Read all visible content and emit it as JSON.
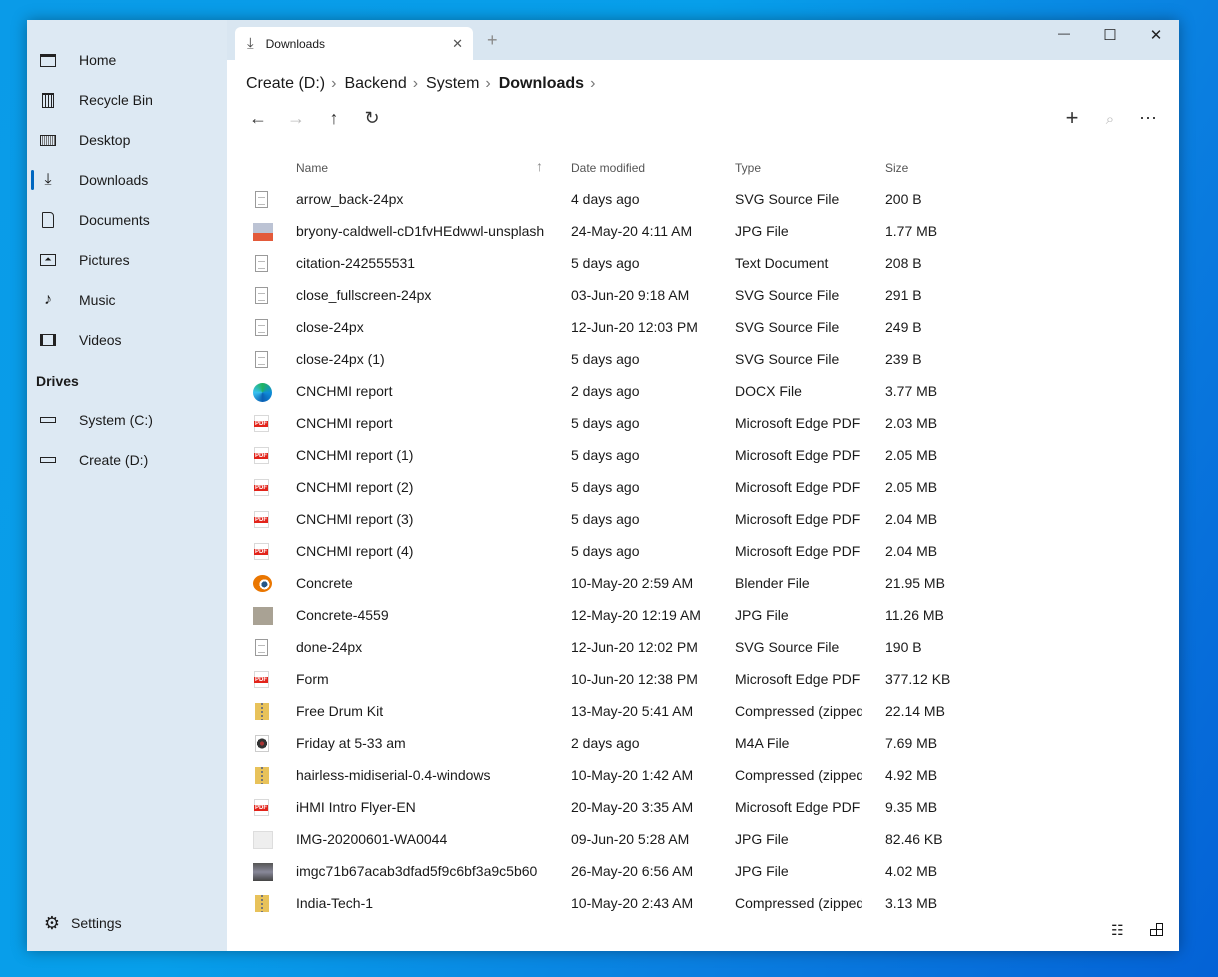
{
  "sidebar": {
    "items": [
      {
        "label": "Home",
        "icon": "home-icon"
      },
      {
        "label": "Recycle Bin",
        "icon": "trash-icon"
      },
      {
        "label": "Desktop",
        "icon": "desktop-icon"
      },
      {
        "label": "Downloads",
        "icon": "download-icon",
        "selected": true
      },
      {
        "label": "Documents",
        "icon": "document-icon"
      },
      {
        "label": "Pictures",
        "icon": "picture-icon"
      },
      {
        "label": "Music",
        "icon": "music-icon"
      },
      {
        "label": "Videos",
        "icon": "video-icon"
      }
    ],
    "drives_header": "Drives",
    "drives": [
      {
        "label": "System (C:)"
      },
      {
        "label": "Create (D:)"
      }
    ],
    "settings": "Settings"
  },
  "tab": {
    "label": "Downloads",
    "close": "✕",
    "new": "+"
  },
  "window_controls": {
    "minimize": "—",
    "maximize": "☐",
    "close": "✕"
  },
  "breadcrumb": [
    "Create (D:)",
    "Backend",
    "System",
    "Downloads"
  ],
  "columns": {
    "name": "Name",
    "date": "Date modified",
    "type": "Type",
    "size": "Size",
    "sort": "ascending"
  },
  "accent": "#0067c0",
  "files": [
    {
      "name": "arrow_back-24px",
      "date": "4 days ago",
      "type": "SVG Source File",
      "size": "200 B",
      "icon": "doc"
    },
    {
      "name": "bryony-caldwell-cD1fvHEdwwl-unsplash",
      "date": "24-May-20 4:11 AM",
      "type": "JPG File",
      "size": "1.77 MB",
      "icon": "img1"
    },
    {
      "name": "citation-242555531",
      "date": "5 days ago",
      "type": "Text Document",
      "size": "208 B",
      "icon": "doc"
    },
    {
      "name": "close_fullscreen-24px",
      "date": "03-Jun-20 9:18 AM",
      "type": "SVG Source File",
      "size": "291 B",
      "icon": "doc"
    },
    {
      "name": "close-24px",
      "date": "12-Jun-20 12:03 PM",
      "type": "SVG Source File",
      "size": "249 B",
      "icon": "doc"
    },
    {
      "name": "close-24px (1)",
      "date": "5 days ago",
      "type": "SVG Source File",
      "size": "239 B",
      "icon": "doc"
    },
    {
      "name": "CNCHMI report",
      "date": "2 days ago",
      "type": "DOCX File",
      "size": "3.77 MB",
      "icon": "edge"
    },
    {
      "name": "CNCHMI report",
      "date": "5 days ago",
      "type": "Microsoft Edge PDF Document",
      "size": "2.03 MB",
      "icon": "pdf"
    },
    {
      "name": "CNCHMI report (1)",
      "date": "5 days ago",
      "type": "Microsoft Edge PDF Document",
      "size": "2.05 MB",
      "icon": "pdf"
    },
    {
      "name": "CNCHMI report (2)",
      "date": "5 days ago",
      "type": "Microsoft Edge PDF Document",
      "size": "2.05 MB",
      "icon": "pdf"
    },
    {
      "name": "CNCHMI report (3)",
      "date": "5 days ago",
      "type": "Microsoft Edge PDF Document",
      "size": "2.04 MB",
      "icon": "pdf"
    },
    {
      "name": "CNCHMI report (4)",
      "date": "5 days ago",
      "type": "Microsoft Edge PDF Document",
      "size": "2.04 MB",
      "icon": "pdf"
    },
    {
      "name": "Concrete",
      "date": "10-May-20 2:59 AM",
      "type": "Blender File",
      "size": "21.95 MB",
      "icon": "blender"
    },
    {
      "name": "Concrete-4559",
      "date": "12-May-20 12:19 AM",
      "type": "JPG File",
      "size": "11.26 MB",
      "icon": "img2"
    },
    {
      "name": "done-24px",
      "date": "12-Jun-20 12:02 PM",
      "type": "SVG Source File",
      "size": "190 B",
      "icon": "doc"
    },
    {
      "name": "Form",
      "date": "10-Jun-20 12:38 PM",
      "type": "Microsoft Edge PDF Document",
      "size": "377.12 KB",
      "icon": "pdf"
    },
    {
      "name": "Free Drum Kit",
      "date": "13-May-20 5:41 AM",
      "type": "Compressed (zipped) Folder",
      "size": "22.14 MB",
      "icon": "zip"
    },
    {
      "name": "Friday at 5-33 am",
      "date": "2 days ago",
      "type": "M4A File",
      "size": "7.69 MB",
      "icon": "audio"
    },
    {
      "name": "hairless-midiserial-0.4-windows",
      "date": "10-May-20 1:42 AM",
      "type": "Compressed (zipped) Folder",
      "size": "4.92 MB",
      "icon": "zip"
    },
    {
      "name": "iHMI Intro Flyer-EN",
      "date": "20-May-20 3:35 AM",
      "type": "Microsoft Edge PDF Document",
      "size": "9.35 MB",
      "icon": "pdf"
    },
    {
      "name": "IMG-20200601-WA0044",
      "date": "09-Jun-20 5:28 AM",
      "type": "JPG File",
      "size": "82.46 KB",
      "icon": "img3"
    },
    {
      "name": "imgc71b67acab3dfad5f9c6bf3a9c5b60",
      "date": "26-May-20 6:56 AM",
      "type": "JPG File",
      "size": "4.02 MB",
      "icon": "img4"
    },
    {
      "name": "India-Tech-1",
      "date": "10-May-20 2:43 AM",
      "type": "Compressed (zipped) Folder",
      "size": "3.13 MB",
      "icon": "zip"
    }
  ]
}
